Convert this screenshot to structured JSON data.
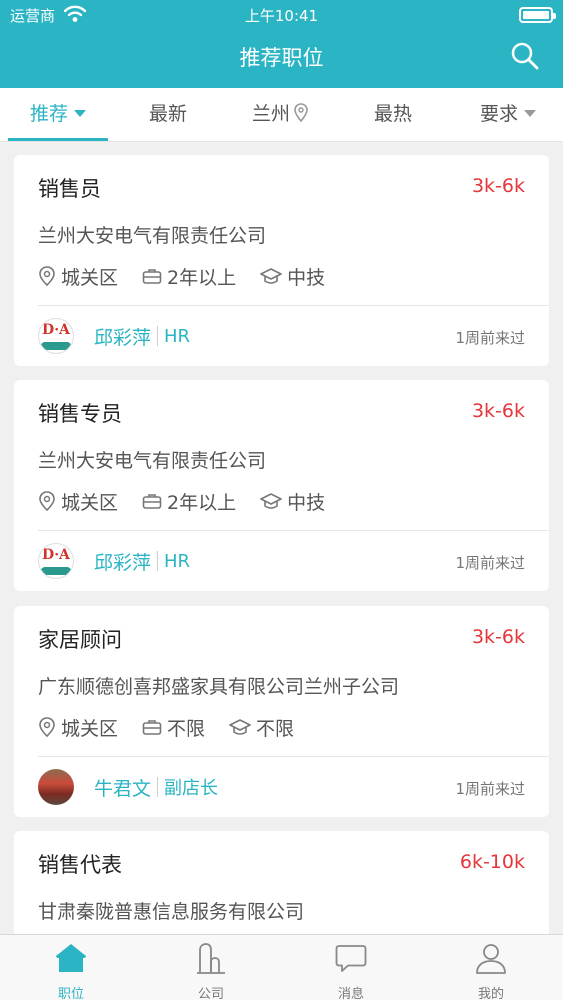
{
  "status_bar": {
    "carrier": "运营商",
    "time": "上午10:41"
  },
  "header": {
    "title": "推荐职位"
  },
  "tabs": [
    {
      "label": "推荐",
      "icon": "caret-down-icon"
    },
    {
      "label": "最新"
    },
    {
      "label": "兰州",
      "icon": "location-pin-icon"
    },
    {
      "label": "最热"
    },
    {
      "label": "要求",
      "icon": "caret-down-icon"
    }
  ],
  "jobs": [
    {
      "title": "销售员",
      "salary": "3k-6k",
      "company": "兰州大安电气有限责任公司",
      "district": "城关区",
      "experience": "2年以上",
      "education": "中技",
      "recruiter_name": "邱彩萍",
      "recruiter_role": "HR",
      "last_seen": "1周前来过"
    },
    {
      "title": "销售专员",
      "salary": "3k-6k",
      "company": "兰州大安电气有限责任公司",
      "district": "城关区",
      "experience": "2年以上",
      "education": "中技",
      "recruiter_name": "邱彩萍",
      "recruiter_role": "HR",
      "last_seen": "1周前来过"
    },
    {
      "title": "家居顾问",
      "salary": "3k-6k",
      "company": "广东顺德创喜邦盛家具有限公司兰州子公司",
      "district": "城关区",
      "experience": "不限",
      "education": "不限",
      "recruiter_name": "牛君文",
      "recruiter_role": "副店长",
      "last_seen": "1周前来过"
    },
    {
      "title": "销售代表",
      "salary": "6k-10k",
      "company": "甘肃秦陇普惠信息服务有限公司"
    }
  ],
  "avatar_logo_text": "D·A",
  "bottom_nav": [
    {
      "label": "职位",
      "icon": "home-icon"
    },
    {
      "label": "公司",
      "icon": "company-icon"
    },
    {
      "label": "消息",
      "icon": "message-icon"
    },
    {
      "label": "我的",
      "icon": "profile-icon"
    }
  ],
  "colors": {
    "brand": "#2bb5c4",
    "salary": "#e5363a"
  }
}
